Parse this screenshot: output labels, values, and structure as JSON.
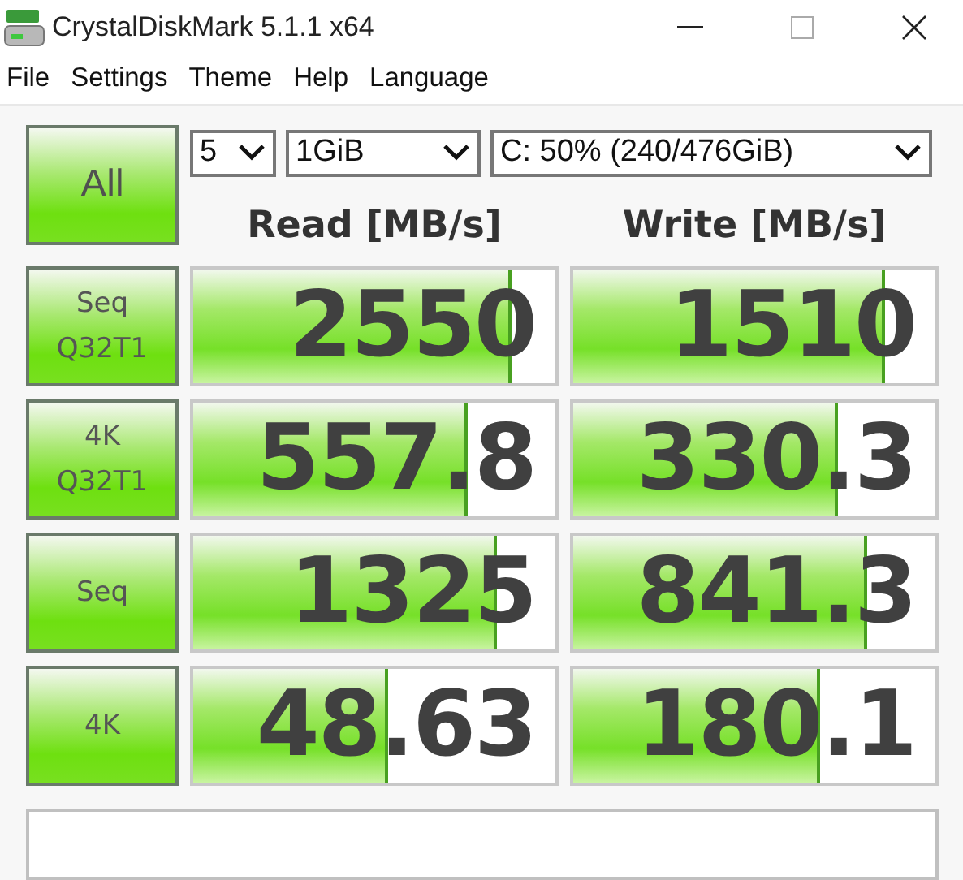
{
  "window": {
    "title": "CrystalDiskMark 5.1.1 x64"
  },
  "menu": [
    "File",
    "Settings",
    "Theme",
    "Help",
    "Language"
  ],
  "all_button": "All",
  "selects": [
    {
      "kind": "count",
      "value": "5"
    },
    {
      "kind": "size",
      "value": "1GiB"
    },
    {
      "kind": "drive",
      "value": "C: 50% (240/476GiB)"
    }
  ],
  "headers": [
    "Read [MB/s]",
    "Write [MB/s]"
  ],
  "rows": [
    {
      "label": "Seq\nQ32T1",
      "read": {
        "value": "2550",
        "level": 0.88
      },
      "write": {
        "value": "1510",
        "level": 0.86
      }
    },
    {
      "label": "4K\nQ32T1",
      "read": {
        "value": "557.8",
        "level": 0.76
      },
      "write": {
        "value": "330.3",
        "level": 0.73
      }
    },
    {
      "label": "Seq",
      "read": {
        "value": "1325",
        "level": 0.84
      },
      "write": {
        "value": "841.3",
        "level": 0.81
      }
    },
    {
      "label": "4K",
      "read": {
        "value": "48.63",
        "level": 0.54
      },
      "write": {
        "value": "180.1",
        "level": 0.68
      }
    }
  ]
}
